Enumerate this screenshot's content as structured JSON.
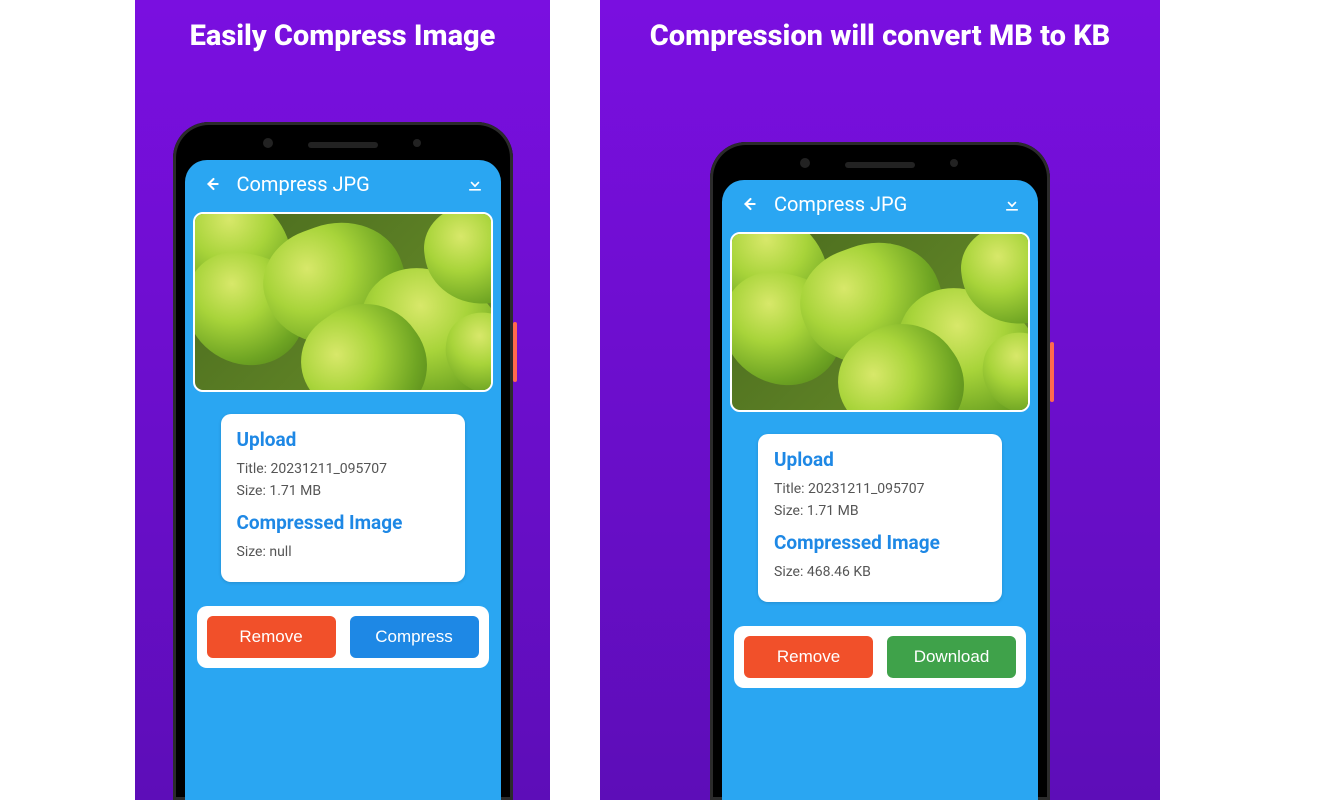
{
  "panels": [
    {
      "headline": "Easily Compress Image",
      "appbar_title": "Compress JPG",
      "upload_heading": "Upload",
      "title_label": "Title: 20231211_095707",
      "size_label": "Size: 1.71 MB",
      "compressed_heading": "Compressed Image",
      "compressed_size": "Size: null",
      "btn_left": "Remove",
      "btn_right": "Compress",
      "btn_right_style": "blue"
    },
    {
      "headline": "Compression will convert MB to KB",
      "appbar_title": "Compress JPG",
      "upload_heading": "Upload",
      "title_label": "Title: 20231211_095707",
      "size_label": "Size: 1.71 MB",
      "compressed_heading": "Compressed Image",
      "compressed_size": "Size: 468.46 KB",
      "btn_left": "Remove",
      "btn_right": "Download",
      "btn_right_style": "green"
    }
  ]
}
